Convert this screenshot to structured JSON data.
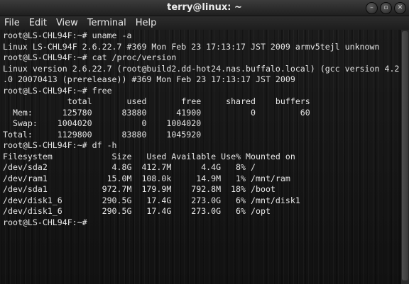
{
  "window": {
    "title": "terry@linux: ~",
    "buttons": {
      "minimize": "–",
      "maximize": "▫",
      "close": "✕"
    }
  },
  "menu": {
    "items": [
      "File",
      "Edit",
      "View",
      "Terminal",
      "Help"
    ]
  },
  "terminal": {
    "lines": [
      "root@LS-CHL94F:~# uname -a",
      "Linux LS-CHL94F 2.6.22.7 #369 Mon Feb 23 17:13:17 JST 2009 armv5tejl unknown",
      "root@LS-CHL94F:~# cat /proc/version",
      "Linux version 2.6.22.7 (root@build2.dd-hot24.nas.buffalo.local) (gcc version 4.2",
      ".0 20070413 (prerelease)) #369 Mon Feb 23 17:13:17 JST 2009",
      "root@LS-CHL94F:~# free",
      "             total       used       free     shared    buffers",
      "  Mem:      125780      83880      41900          0         60",
      "  Swap:    1004020          0    1004020",
      "Total:     1129800      83880    1045920",
      "root@LS-CHL94F:~# df -h",
      "Filesystem            Size   Used Available Use% Mounted on",
      "/dev/sda2             4.8G  412.7M      4.4G   8% /",
      "/dev/ram1            15.0M  108.0k     14.9M   1% /mnt/ram",
      "/dev/sda1           972.7M  179.9M    792.8M  18% /boot",
      "/dev/disk1_6        290.5G   17.4G    273.0G   6% /mnt/disk1",
      "/dev/disk1_6        290.5G   17.4G    273.0G   6% /opt",
      "root@LS-CHL94F:~# "
    ]
  }
}
